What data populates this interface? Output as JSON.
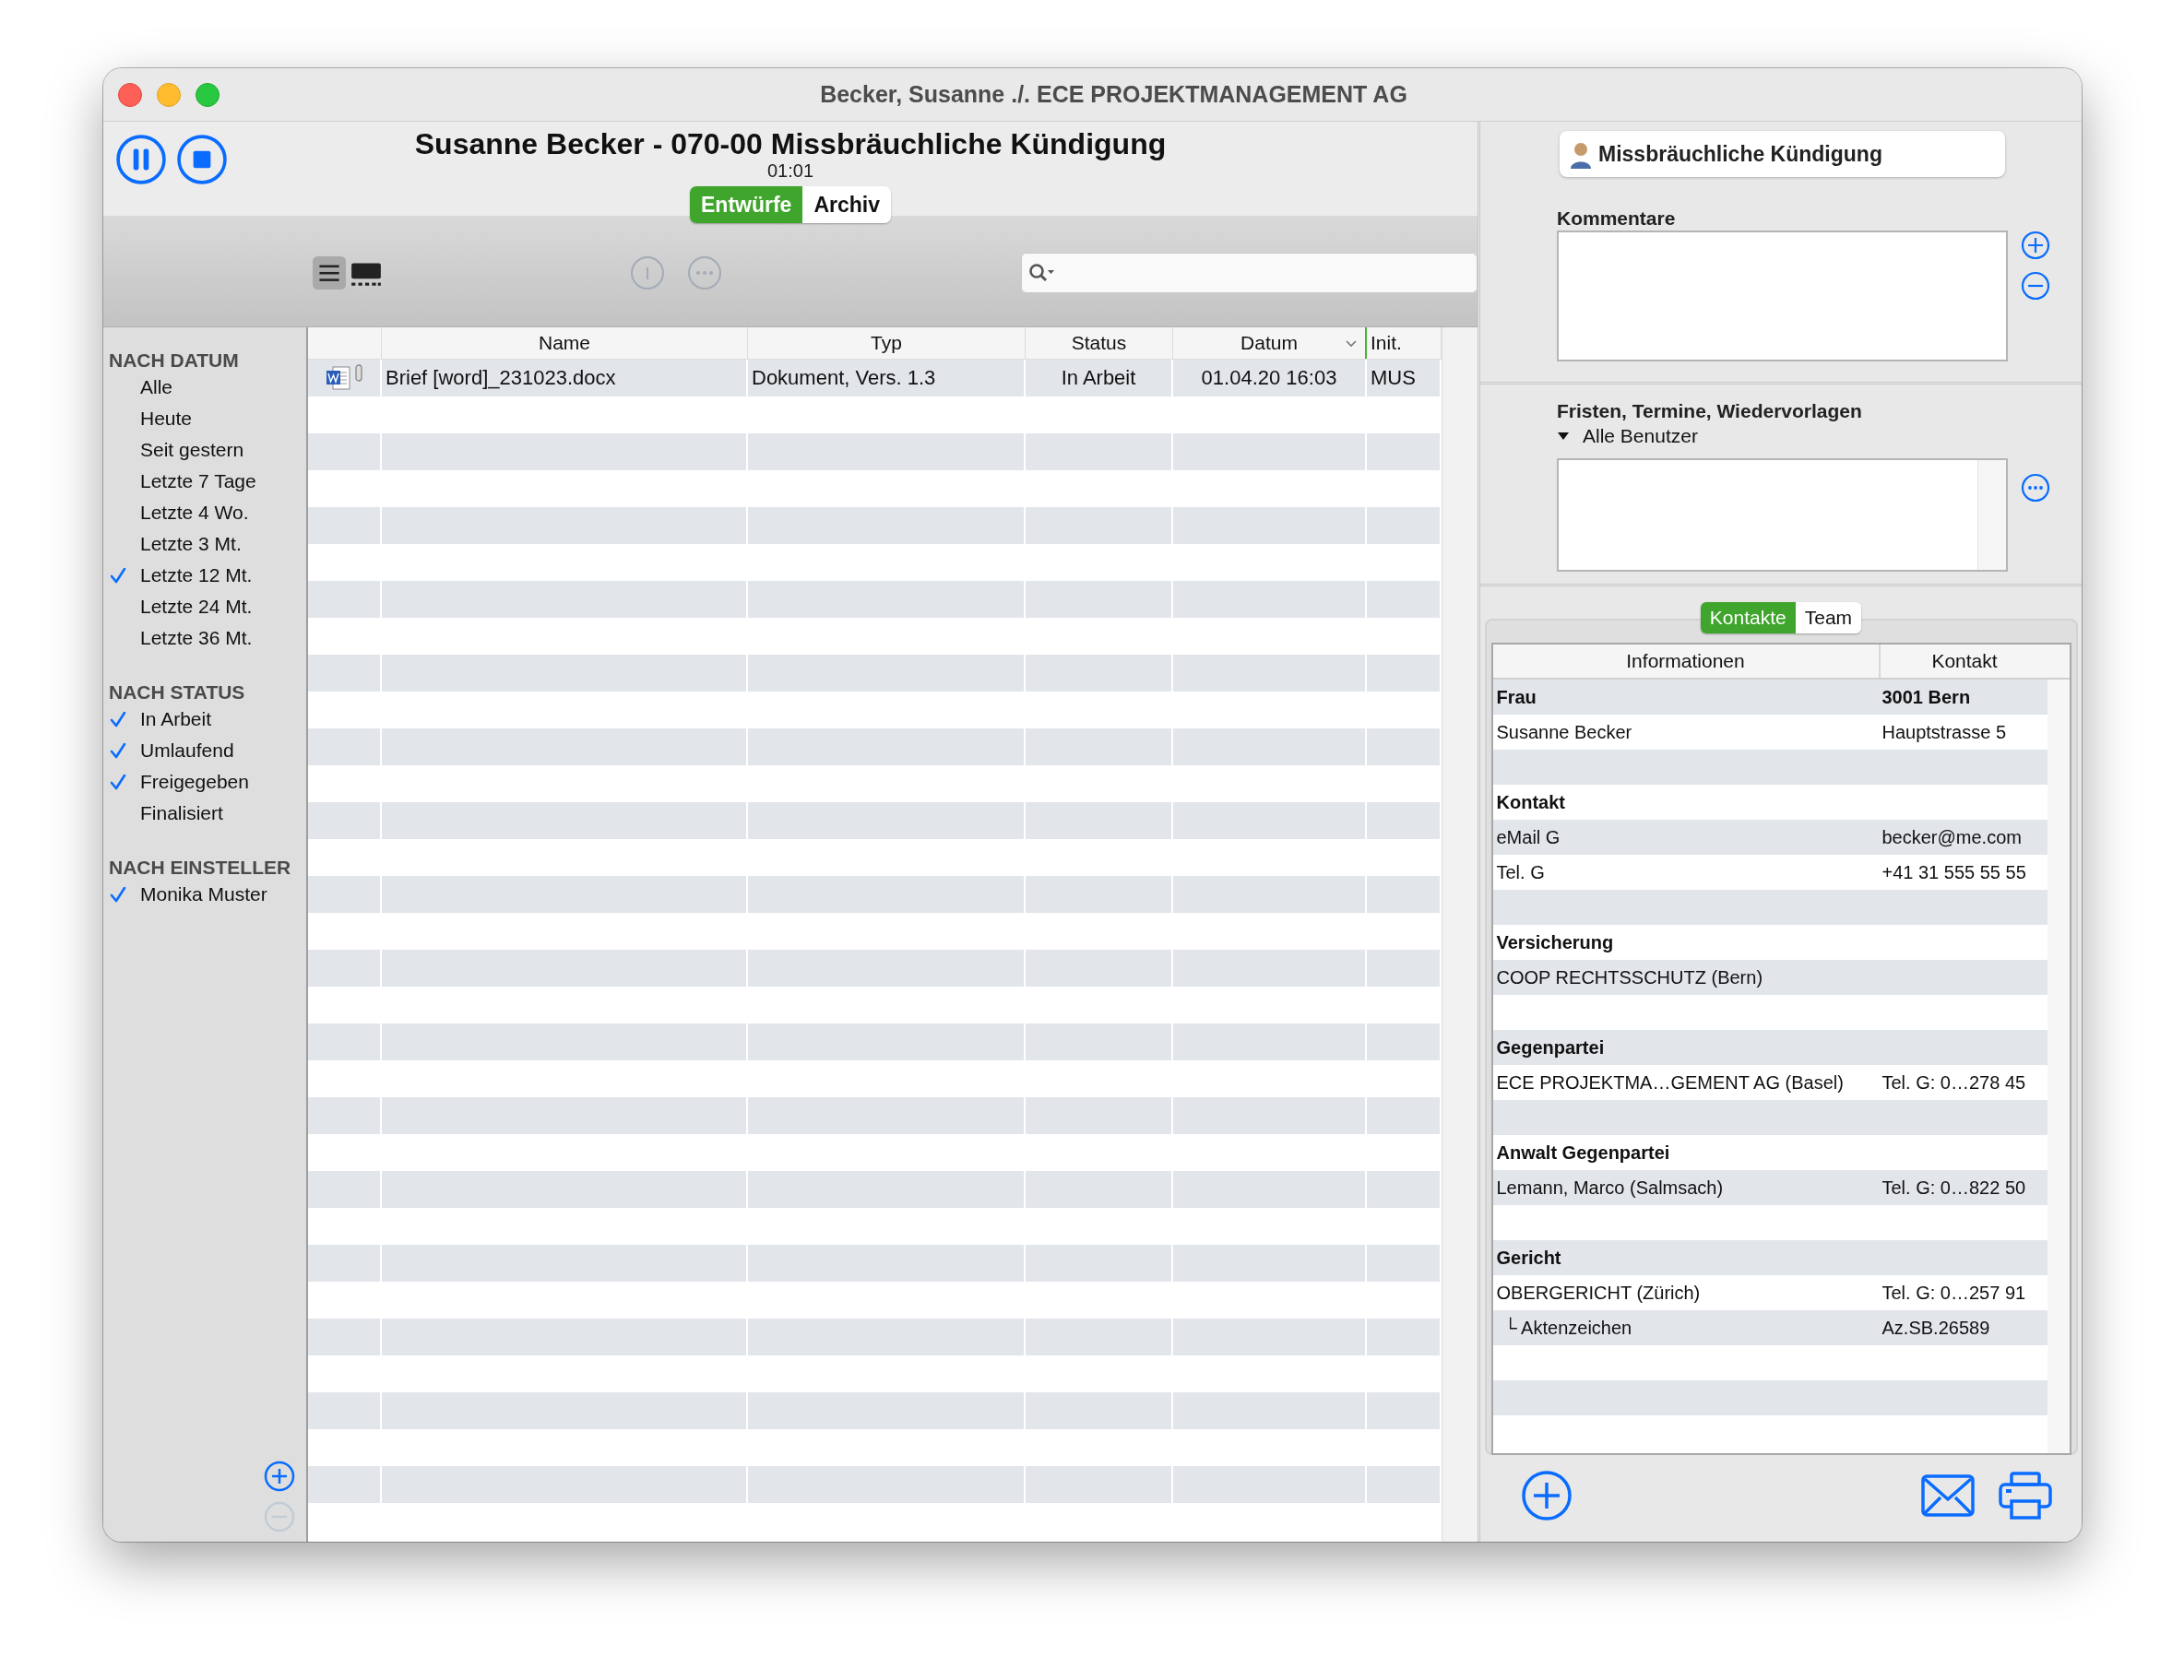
{
  "window": {
    "title": "Becker, Susanne ./. ECE PROJEKTMANAGEMENT AG"
  },
  "header": {
    "title": "Susanne Becker - 070-00 Missbräuchliche Kündigung",
    "timer": "01:01"
  },
  "view_tabs": [
    {
      "label": "Entwürfe",
      "selected": true
    },
    {
      "label": "Archiv",
      "selected": false
    }
  ],
  "sidebar": {
    "sections": [
      {
        "heading": "NACH DATUM",
        "items": [
          {
            "label": "Alle",
            "checked": false
          },
          {
            "label": "Heute",
            "checked": false
          },
          {
            "label": "Seit gestern",
            "checked": false
          },
          {
            "label": "Letzte 7 Tage",
            "checked": false
          },
          {
            "label": "Letzte 4 Wo.",
            "checked": false
          },
          {
            "label": "Letzte 3 Mt.",
            "checked": false
          },
          {
            "label": "Letzte 12 Mt.",
            "checked": true
          },
          {
            "label": "Letzte 24 Mt.",
            "checked": false
          },
          {
            "label": "Letzte 36 Mt.",
            "checked": false
          }
        ]
      },
      {
        "heading": "NACH STATUS",
        "items": [
          {
            "label": "In Arbeit",
            "checked": true
          },
          {
            "label": "Umlaufend",
            "checked": true
          },
          {
            "label": "Freigegeben",
            "checked": true
          },
          {
            "label": "Finalisiert",
            "checked": false
          }
        ]
      },
      {
        "heading": "NACH EINSTELLER",
        "items": [
          {
            "label": "Monika Muster",
            "checked": true
          }
        ]
      }
    ]
  },
  "documents": {
    "columns": [
      {
        "label": "Name",
        "sorted": false
      },
      {
        "label": "Typ",
        "sorted": false
      },
      {
        "label": "Status",
        "sorted": false
      },
      {
        "label": "Datum",
        "sorted": true
      },
      {
        "label": "Init.",
        "sorted": false
      }
    ],
    "rows": [
      {
        "name": "Brief [word]_231023.docx",
        "type": "Dokument, Vers. 1.3",
        "status": "In Arbeit",
        "date": "01.04.20 16:03",
        "initials": "MUS",
        "attachment": true
      }
    ]
  },
  "case_badge": "Missbräuchliche Kündigung",
  "comments": {
    "label": "Kommentare"
  },
  "deadlines": {
    "label": "Fristen, Termine, Wiedervorlagen",
    "filter": "Alle Benutzer"
  },
  "contact_tabs": [
    {
      "label": "Kontakte",
      "selected": true
    },
    {
      "label": "Team",
      "selected": false
    }
  ],
  "contacts": {
    "columns": [
      "Informationen",
      "Kontakt"
    ],
    "rows": [
      {
        "kind": "heading",
        "info": "Frau",
        "contact": "3001 Bern"
      },
      {
        "kind": "entry",
        "info": "Susanne Becker",
        "contact": "Hauptstrasse 5"
      },
      {
        "kind": "blank"
      },
      {
        "kind": "heading",
        "info": "Kontakt"
      },
      {
        "kind": "entry",
        "info": "eMail G",
        "contact": "becker@me.com"
      },
      {
        "kind": "entry",
        "info": "Tel. G",
        "contact": "+41 31 555 55 55"
      },
      {
        "kind": "blank"
      },
      {
        "kind": "heading",
        "info": "Versicherung"
      },
      {
        "kind": "entry",
        "info": "COOP RECHTSSCHUTZ (Bern)"
      },
      {
        "kind": "blank"
      },
      {
        "kind": "heading",
        "info": "Gegenpartei"
      },
      {
        "kind": "entry",
        "info": "ECE PROJEKTMA…GEMENT AG (Basel)",
        "contact": "Tel. G: 0…278 45"
      },
      {
        "kind": "blank"
      },
      {
        "kind": "heading",
        "info": "Anwalt Gegenpartei"
      },
      {
        "kind": "entry",
        "info": "Lemann, Marco (Salmsach)",
        "contact": "Tel. G: 0…822 50"
      },
      {
        "kind": "blank"
      },
      {
        "kind": "heading",
        "info": "Gericht"
      },
      {
        "kind": "entry",
        "info": "OBERGERICHT (Zürich)",
        "contact": "Tel. G: 0…257 91"
      },
      {
        "kind": "sub",
        "info": "└ Aktenzeichen",
        "contact": "Az.SB.26589"
      },
      {
        "kind": "blank"
      },
      {
        "kind": "blank"
      },
      {
        "kind": "blank"
      }
    ]
  }
}
